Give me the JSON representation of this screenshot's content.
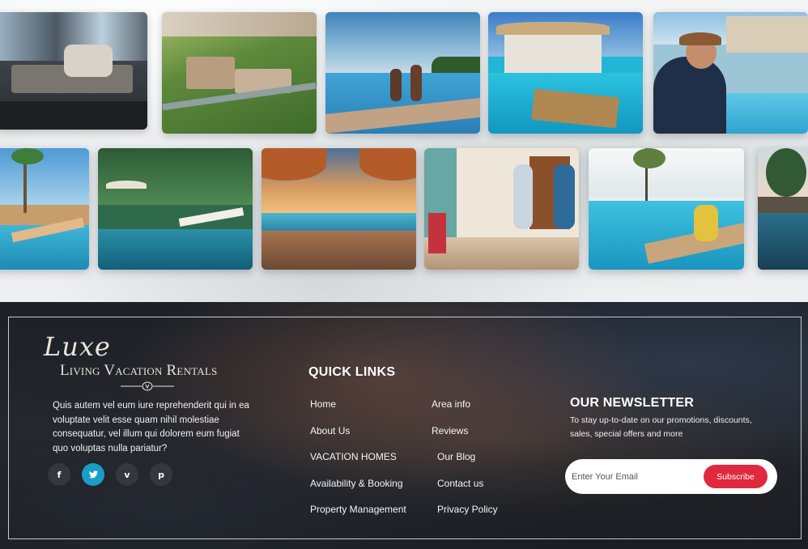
{
  "gallery": {
    "row1": [
      {
        "name": "living-room-photo",
        "alt": "luxury living room"
      },
      {
        "name": "resort-aerial-photo",
        "alt": "resort aerial view"
      },
      {
        "name": "infinity-pool-kids-photo",
        "alt": "kids jumping in infinity pool"
      },
      {
        "name": "villa-floating-breakfast-photo",
        "alt": "villa with floating breakfast"
      },
      {
        "name": "man-laptop-pool-photo",
        "alt": "man with laptop by pool"
      }
    ],
    "row2": [
      {
        "name": "beach-loungers-photo",
        "alt": "beach loungers under palms"
      },
      {
        "name": "tropical-pool-photo",
        "alt": "tropical pool with palms"
      },
      {
        "name": "sunset-pool-photo",
        "alt": "sunset pool with umbrellas"
      },
      {
        "name": "couple-arriving-photo",
        "alt": "couple arriving with luggage"
      },
      {
        "name": "woman-poolside-photo",
        "alt": "woman relaxing poolside"
      },
      {
        "name": "palm-pool-photo",
        "alt": "palm trees and pool"
      }
    ]
  },
  "footer": {
    "logo": {
      "script": "Luxe",
      "subtitle": "Living Vacation Rentals"
    },
    "about": "Quis autem vel eum iure reprehenderit qui in ea voluptate velit esse quam nihil molestiae consequatur, vel illum qui dolorem eum fugiat quo voluptas nulla pariatur?",
    "socials": [
      {
        "icon": "facebook-icon",
        "glyph": "f"
      },
      {
        "icon": "twitter-icon",
        "glyph": "t"
      },
      {
        "icon": "vimeo-icon",
        "glyph": "v"
      },
      {
        "icon": "pinterest-icon",
        "glyph": "p"
      }
    ],
    "quick_links": {
      "title": "QUICK LINKS",
      "left": [
        "Home",
        "About Us",
        "VACATION HOMES",
        "Availability & Booking",
        "Property Management"
      ],
      "right": [
        "Area info",
        "Reviews",
        "Our Blog",
        "Contact us",
        "Privacy Policy"
      ]
    },
    "newsletter": {
      "title": "OUR NEWSLETTER",
      "text": "To stay up-to-date on our promotions, discounts, sales, special offers and more",
      "placeholder": "Enter Your Email",
      "button": "Subscribe"
    },
    "colors": {
      "accent": "#e0283e",
      "social_active": "#1a9dc7"
    }
  }
}
